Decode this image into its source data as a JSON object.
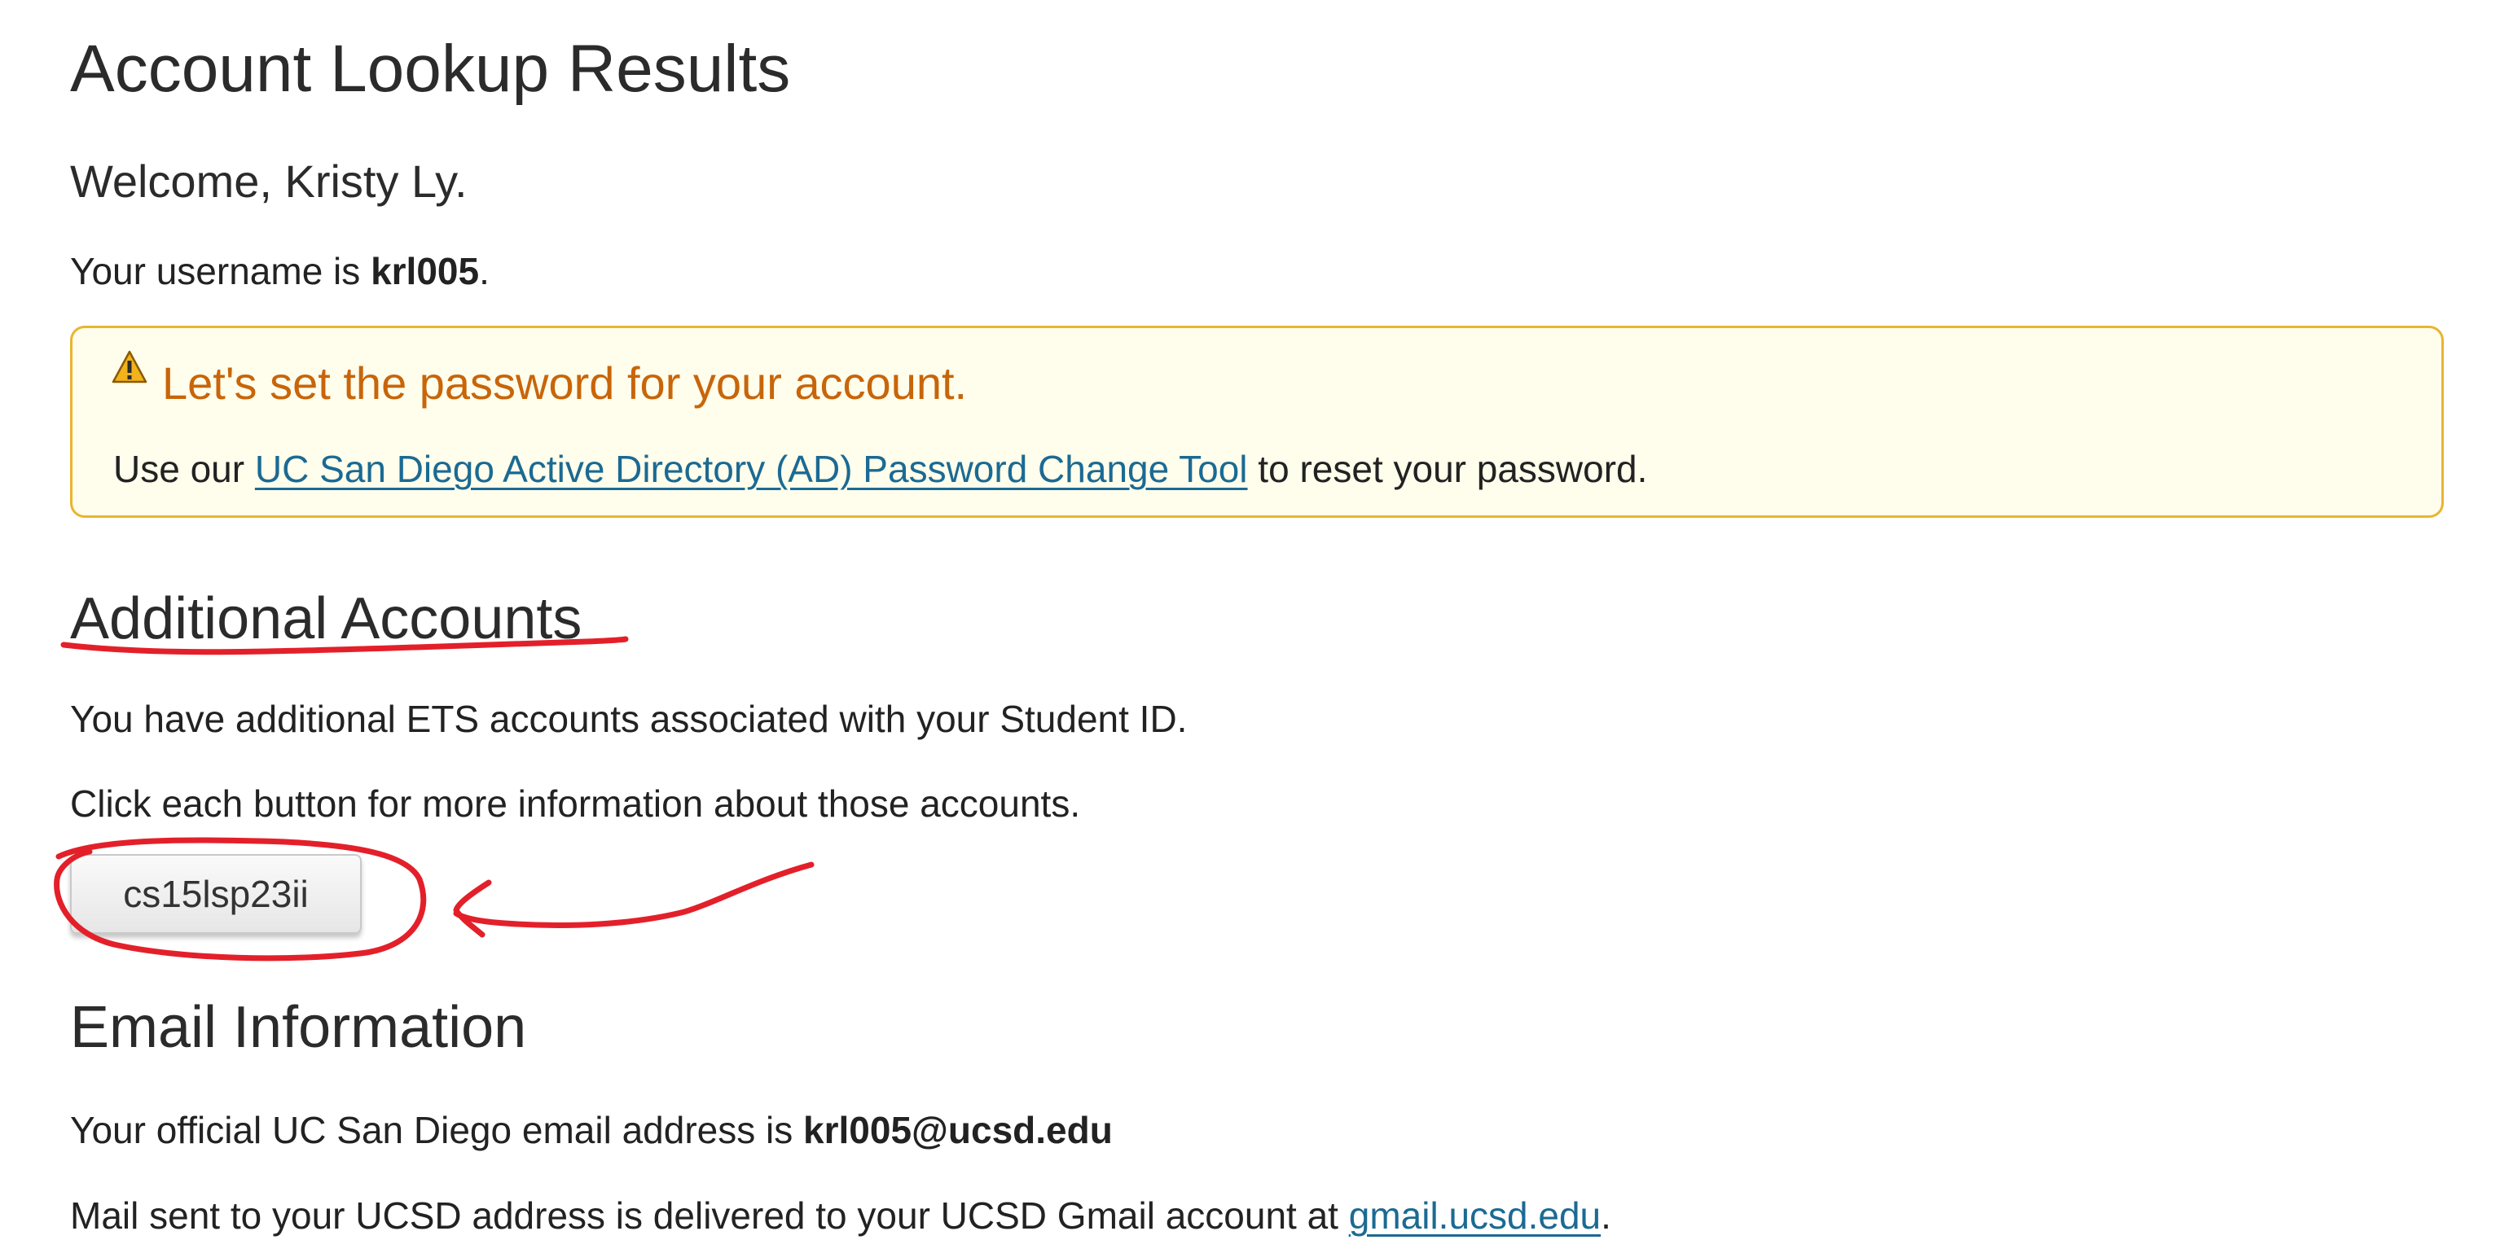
{
  "page": {
    "title": "Account Lookup Results",
    "welcome": "Welcome, Kristy Ly.",
    "username_prefix": "Your username is ",
    "username": "krl005",
    "username_suffix": "."
  },
  "alert": {
    "icon": "warning-icon",
    "title": "Let's set the password for your account.",
    "body_prefix": "Use our ",
    "link_text": "UC San Diego Active Directory (AD) Password Change Tool",
    "body_suffix": " to reset your password."
  },
  "additional_accounts": {
    "heading": "Additional Accounts",
    "line1": "You have additional ETS accounts associated with your Student ID.",
    "line2": "Click each button for more information about those accounts.",
    "buttons": [
      "cs15lsp23ii"
    ]
  },
  "email": {
    "heading": "Email Information",
    "official_prefix": "Your official UC San Diego email address is ",
    "address": "krl005@ucsd.edu",
    "gmail_prefix": "Mail sent to your UCSD address is delivered to your UCSD Gmail account at ",
    "gmail_link": "gmail.ucsd.edu",
    "gmail_suffix": "."
  },
  "colors": {
    "alert_background": "#fffdeb",
    "alert_border": "#e9b52f",
    "alert_title": "#c8650a",
    "link": "#1b6a93",
    "annotation": "#e3202a"
  }
}
